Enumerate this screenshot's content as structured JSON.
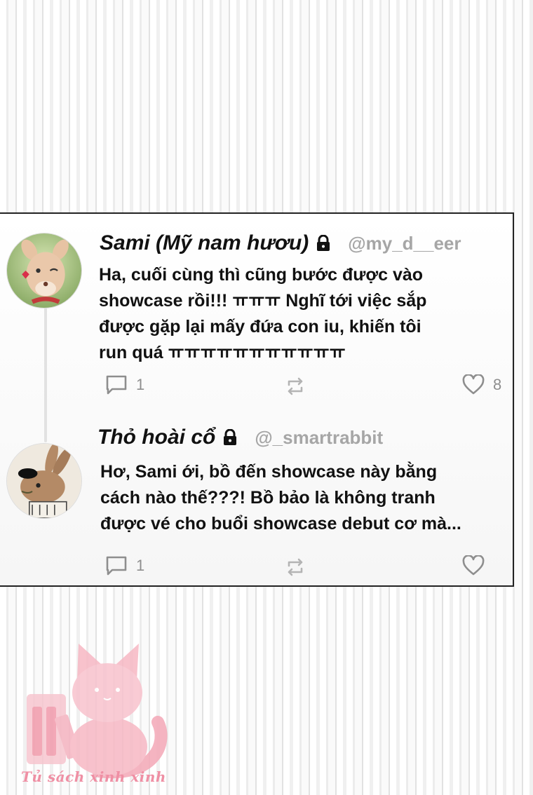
{
  "posts": [
    {
      "name": "Sami (Mỹ nam hươu)",
      "handle": "@my_d__eer",
      "text": "Ha, cuối cùng thì cũng bước được vào\nshowcase rồi!!! ㅠㅠㅠ Nghĩ tới việc sắp\nđược gặp lại mấy đứa con iu, khiến tôi\nrun quá ㅠㅠㅠㅠㅠㅠㅠㅠㅠㅠㅠ",
      "reply_count": "1",
      "like_count": "8",
      "avatar_icon": "deer-avatar"
    },
    {
      "name": "Thỏ hoài cổ",
      "handle": "@_smartrabbit",
      "text": "Hơ, Sami ới, bồ đến showcase này bằng\ncách nào thế???! Bồ bảo là không tranh\nđược vé cho buổi showcase debut cơ mà...",
      "reply_count": "1",
      "avatar_icon": "rabbit-avatar"
    }
  ],
  "watermark": {
    "text": "Tủ sách xinh xinh",
    "color": "#ef8fa4"
  },
  "colors": {
    "text": "#111111",
    "muted": "#8e8e8e",
    "handle": "#a6a6a6"
  }
}
